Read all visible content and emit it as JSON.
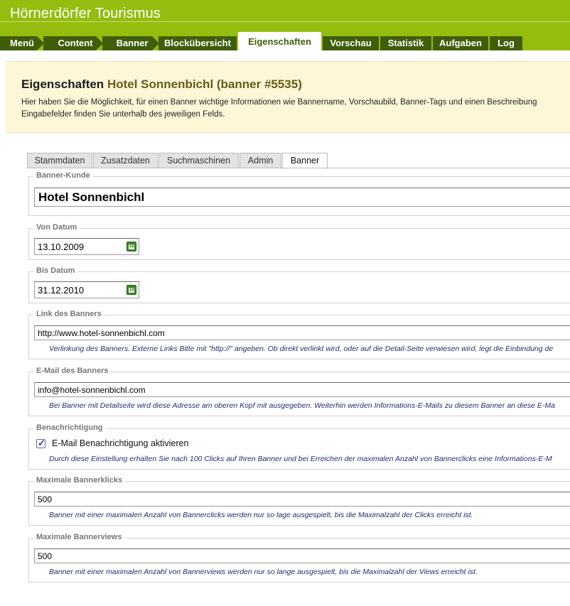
{
  "header": {
    "title": "Hörnerdörfer Tourismus"
  },
  "nav": {
    "items": [
      {
        "label": "Menü"
      },
      {
        "label": "Content"
      },
      {
        "label": "Banner"
      },
      {
        "label": "Blockübersicht"
      },
      {
        "label": "Eigenschaften"
      },
      {
        "label": "Vorschau"
      },
      {
        "label": "Statistik"
      },
      {
        "label": "Aufgaben"
      },
      {
        "label": "Log"
      }
    ],
    "active": "Eigenschaften"
  },
  "info": {
    "title_prefix": "Eigenschaften",
    "title_highlight": "Hotel Sonnenbichl (banner #5535)",
    "description_line1": "Hier haben Sie die Möglichkeit, für einen Banner wichtige Informationen wie Bannername, Vorschaubild, Banner-Tags und einen Beschreibung",
    "description_line2": "Eingabefelder finden Sie unterhalb des jeweiligen Felds."
  },
  "tabs": [
    {
      "label": "Stammdaten"
    },
    {
      "label": "Zusatzdaten"
    },
    {
      "label": "Suchmaschinen"
    },
    {
      "label": "Admin"
    },
    {
      "label": "Banner"
    }
  ],
  "form": {
    "banner_kunde": {
      "legend": "Banner-Kunde",
      "value": "Hotel Sonnenbichl"
    },
    "von_datum": {
      "legend": "Von Datum",
      "value": "13.10.2009"
    },
    "bis_datum": {
      "legend": "Bis Datum",
      "value": "31.12.2010"
    },
    "link": {
      "legend": "Link des Banners",
      "value": "http://www.hotel-sonnenbichl.com",
      "hint": "Verlinkung des Banners. Externe Links Bitte mit \"http://\" angeben. Ob direkt verlinkt wird, oder auf die Detail-Seite verwiesen wird, legt die Einbindung de"
    },
    "email": {
      "legend": "E-Mail des Banners",
      "value": "info@hotel-sonnenbichl.com",
      "hint": "Bei Banner mit Detailseite wird diese Adresse am oberen Kopf mit ausgegeben. Weiterhin werden Informations-E-Mails zu diesem Banner an diese E-Ma"
    },
    "benachrichtigung": {
      "legend": "Benachrichtigung",
      "checkbox_label": "E-Mail Benachrichtigung aktivieren",
      "checked": true,
      "hint": "Durch diese Einstellung erhalten Sie nach 100 Clicks auf Ihren Banner und bei Erreichen der maximalen Anzahl von Bannerclicks eine Informations-E-M"
    },
    "max_clicks": {
      "legend": "Maximale Bannerklicks",
      "value": "500",
      "hint": "Banner mit einer maximalen Anzahl von Bannerclicks werden nur so lage ausgespielt, bis die Maximalzahl der Clicks erreicht ist."
    },
    "max_views": {
      "legend": "Maximale Bannerviews",
      "value": "500",
      "hint": "Banner mit einer maximalen Anzahl von Bannerviews werden nur so lange ausgespielt, bis die Maximalzahl der Views erreicht ist."
    }
  },
  "colors": {
    "brand_green": "#95bd0f",
    "nav_dark": "#3f5e0a",
    "info_bg": "#fdf7d8",
    "title_highlight": "#6b5a16",
    "hint_text": "#1e2e6e"
  }
}
